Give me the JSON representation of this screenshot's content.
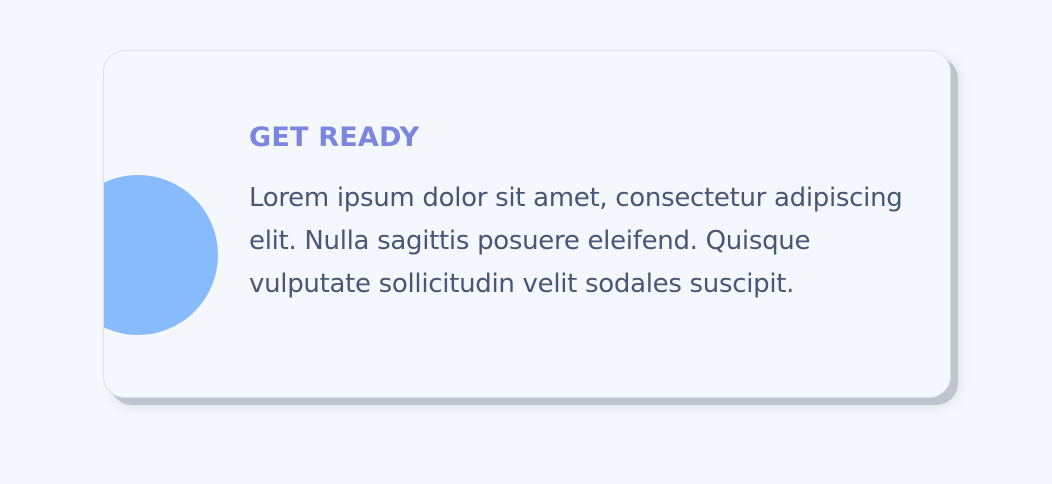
{
  "card": {
    "title": "GET READY",
    "body": "Lorem ipsum dolor sit amet, consectetur adipiscing elit. Nulla sagittis posuere eleifend. Quisque vulputate sollicitudin velit sodales suscipit."
  },
  "colors": {
    "accent_circle": "#88bbfc",
    "title": "#7b86de",
    "body_text": "#4a5676",
    "background": "#f4f7fb"
  }
}
